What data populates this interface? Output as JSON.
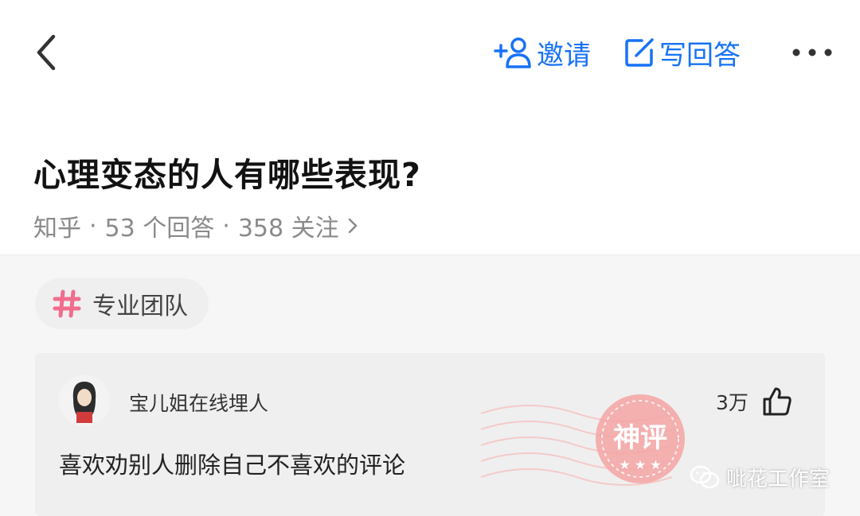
{
  "colors": {
    "accent": "#1772f6",
    "tag_hash": "#f06d8c",
    "stamp": "#f4a7a7"
  },
  "navbar": {
    "back_icon": "chevron-left-icon",
    "invite_label": "邀请",
    "write_answer_label": "写回答",
    "more_icon": "more-horizontal-icon"
  },
  "question": {
    "title": "心理变态的人有哪些表现?",
    "meta": {
      "source": "知乎",
      "answers": "53 个回答",
      "followers": "358 关注",
      "separator": "·"
    }
  },
  "tag": {
    "label": "专业团队",
    "icon": "hash-icon"
  },
  "comment": {
    "username": "宝儿姐在线埋人",
    "likes": "3万",
    "text": "喜欢劝别人删除自己不喜欢的评论",
    "stamp_label": "神评"
  },
  "watermark": {
    "text": "呲花工作室"
  }
}
